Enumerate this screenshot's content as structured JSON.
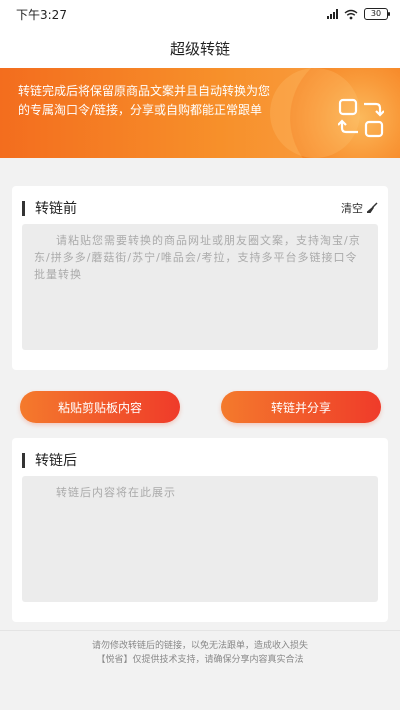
{
  "statusbar": {
    "time": "下午3:27",
    "battery": "30"
  },
  "header": {
    "title": "超级转链"
  },
  "banner": {
    "text": "转链完成后将保留原商品文案并且自动转换为您的专属淘口令/链接，分享或自购都能正常跟单"
  },
  "before": {
    "title": "转链前",
    "clear_label": "清空",
    "placeholder": "请粘贴您需要转换的商品网址或朋友圈文案，支持淘宝/京东/拼多多/蘑菇街/苏宁/唯品会/考拉，支持多平台多链接口令批量转换"
  },
  "actions": {
    "paste_label": "粘贴剪贴板内容",
    "convert_label": "转链并分享"
  },
  "after": {
    "title": "转链后",
    "placeholder": "转链后内容将在此展示"
  },
  "footer": {
    "line1": "请勿修改转链后的链接，以免无法跟单，造成收入损失",
    "line2": "【悦省】仅提供技术支持，请确保分享内容真实合法"
  }
}
